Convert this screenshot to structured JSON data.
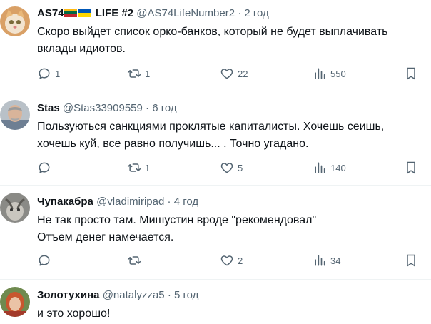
{
  "colors": {
    "text": "#0f1419",
    "muted": "#536471",
    "divider": "#eff3f4",
    "lithuania_flag": [
      "#fdb913",
      "#006a44",
      "#c1272d"
    ],
    "ukraine_flag": [
      "#0057b7",
      "#ffd700"
    ]
  },
  "tweets": [
    {
      "name_prefix": "AS74",
      "name_suffix": "LIFE #2",
      "handle": "@AS74LifeNumber2",
      "dot": "·",
      "time": "2 год",
      "lines": [
        "Скоро выйдет список орко-банков, который не будет выплачивать",
        "вклады идиотов."
      ],
      "replies": "1",
      "retweets": "1",
      "likes": "22",
      "views": "550",
      "avatar": "cat-avatar"
    },
    {
      "name": "Stas",
      "handle": "@Stas33909559",
      "dot": "·",
      "time": "6 год",
      "lines": [
        "Пользуються санкциями проклятые капиталисты. Хочешь сеишь,",
        "хочешь куй, все равно получишь... . Точно угадано."
      ],
      "replies": "",
      "retweets": "1",
      "likes": "5",
      "views": "140",
      "avatar": "man-avatar"
    },
    {
      "name": "Чупакабра",
      "handle": "@vladimiripad",
      "dot": "·",
      "time": "4 год",
      "lines": [
        "Не так просто там. Мишустин вроде \"рекомендовал\"",
        "Отъем денег намечается."
      ],
      "replies": "",
      "retweets": "",
      "likes": "2",
      "views": "34",
      "avatar": "goat-avatar"
    },
    {
      "name": "Золотухина",
      "handle": "@natalyzza5",
      "dot": "·",
      "time": "5 год",
      "lines": [
        "и это хорошо!"
      ],
      "avatar": "woman-avatar"
    }
  ]
}
